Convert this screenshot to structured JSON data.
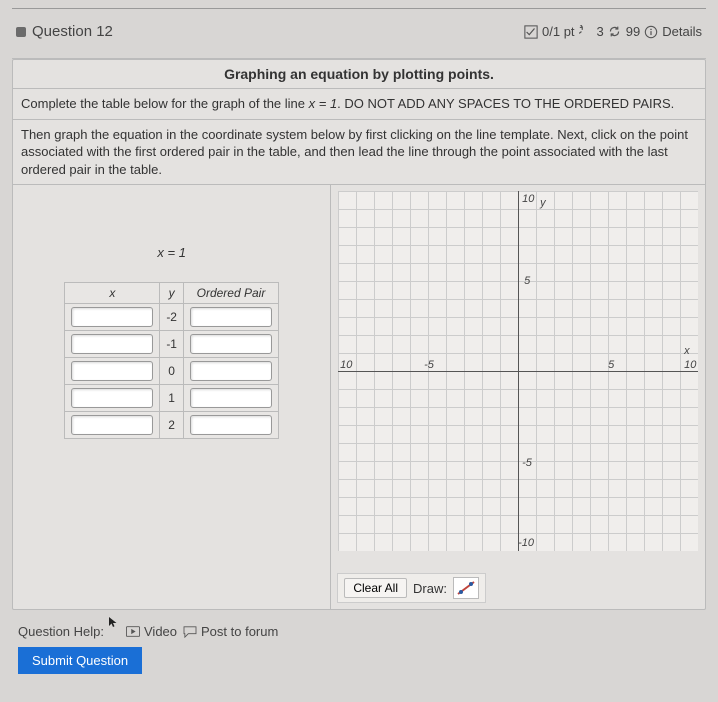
{
  "header": {
    "question_label": "Question 12",
    "score_text": "0/1 pt",
    "retry_count": "3",
    "attempts_left": "99",
    "details_label": "Details"
  },
  "section_title": "Graphing an equation by plotting points.",
  "instruction1_pre": "Complete the table below for the graph of the line ",
  "instruction1_eq": "x = 1",
  "instruction1_post": ". DO NOT ADD ANY SPACES TO THE ORDERED PAIRS.",
  "instruction2": "Then graph the equation in the coordinate system below by first clicking on the line template.  Next, click on the point associated with the first ordered pair in the table, and then lead the line through the point associated with the last ordered pair in the table.",
  "equation_label": "x = 1",
  "table": {
    "headers": {
      "x": "x",
      "y": "y",
      "pair": "Ordered Pair"
    },
    "y_values": [
      "-2",
      "-1",
      "0",
      "1",
      "2"
    ]
  },
  "graph": {
    "labels": {
      "x_axis": "x",
      "y_axis": "y",
      "ticks": {
        "neg10": "-10",
        "neg5": "-5",
        "pos5": "5",
        "pos10a": "10",
        "pos10b": "10",
        "left10": "10"
      }
    },
    "clear_label": "Clear All",
    "draw_label": "Draw:"
  },
  "help": {
    "prefix": "Question Help:",
    "video": "Video",
    "forum": "Post to forum"
  },
  "submit_label": "Submit Question",
  "chart_data": {
    "type": "line",
    "title": "",
    "xlabel": "x",
    "ylabel": "y",
    "xlim": [
      -10,
      10
    ],
    "ylim": [
      -10,
      10
    ],
    "grid": true,
    "series": []
  }
}
